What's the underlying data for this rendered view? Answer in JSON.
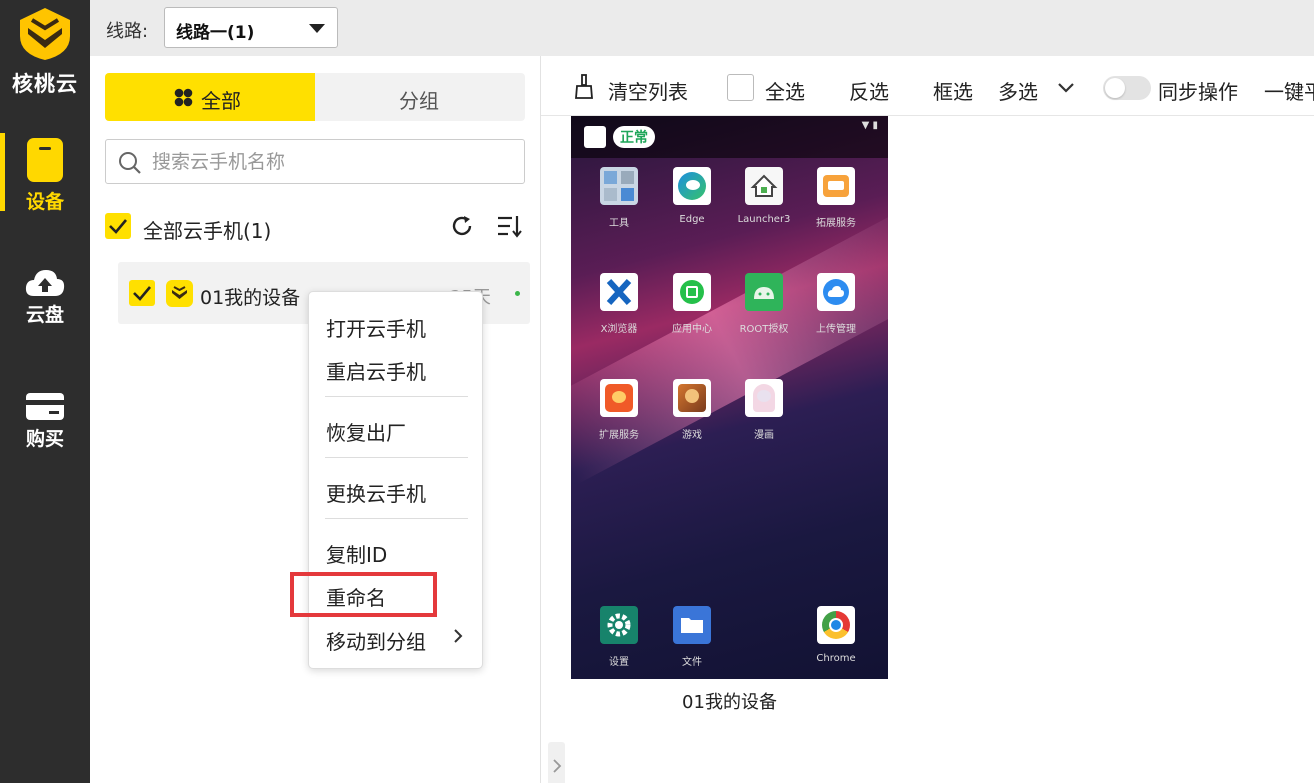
{
  "brand": {
    "name": "核桃云"
  },
  "rail": {
    "items": [
      {
        "label": "设备",
        "icon": "phone-icon"
      },
      {
        "label": "云盘",
        "icon": "cloud-upload-icon"
      },
      {
        "label": "购买",
        "icon": "card-icon"
      }
    ],
    "active_color": "#ffd800"
  },
  "topbar": {
    "route_label": "线路:",
    "route_value": "线路一(1)"
  },
  "panel": {
    "tabs": [
      {
        "label": "全部"
      },
      {
        "label": "分组"
      }
    ],
    "search_placeholder": "搜索云手机名称",
    "all_label": "全部云手机(1)",
    "device": {
      "name": "01我的设备",
      "days": "25天",
      "status_color": "#3cb64a"
    }
  },
  "context_menu": {
    "items": [
      {
        "label": "打开云手机"
      },
      {
        "label": "重启云手机"
      },
      {
        "label": "恢复出厂"
      },
      {
        "label": "更换云手机"
      },
      {
        "label": "复制ID"
      },
      {
        "label": "重命名",
        "highlighted": true
      },
      {
        "label": "移动到分组",
        "has_submenu": true
      }
    ]
  },
  "toolbar": {
    "clear_list": "清空列表",
    "select_all": "全选",
    "invert": "反选",
    "box_select": "框选",
    "multi_select": "多选",
    "sync_ops": "同步操作",
    "one_key": "一键平"
  },
  "phone": {
    "status_badge": "正常",
    "apps": [
      {
        "name": "工具"
      },
      {
        "name": "Edge"
      },
      {
        "name": "Launcher3"
      },
      {
        "name": "拓展服务"
      },
      {
        "name": "X浏览器"
      },
      {
        "name": "应用中心"
      },
      {
        "name": "ROOT授权"
      },
      {
        "name": "上传管理"
      },
      {
        "name": "扩展服务"
      },
      {
        "name": "游戏"
      },
      {
        "name": "漫画"
      }
    ],
    "dock": [
      {
        "name": "设置"
      },
      {
        "name": "文件"
      },
      {
        "name": "Chrome"
      }
    ],
    "caption": "01我的设备"
  },
  "colors": {
    "accent": "#ffe000",
    "highlight_border": "#e4393c",
    "status_green": "#1fa65a"
  }
}
